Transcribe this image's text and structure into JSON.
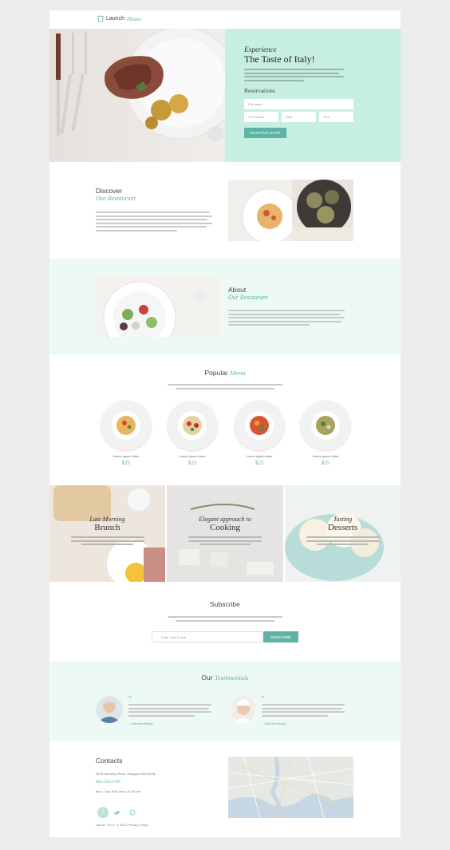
{
  "brand": {
    "name_a": "Launch",
    "name_b": "House"
  },
  "hero": {
    "pre": "Experience",
    "title": "The Taste of Italy!",
    "reservations_label": "Reservations",
    "name_placeholder": "Full name",
    "guests_placeholder": "# of Guests",
    "date_placeholder": "Date",
    "time_placeholder": "Time",
    "reserve_button": "RESERVE NOW!"
  },
  "discover": {
    "title": "Discover",
    "subtitle": "Our Restaurant"
  },
  "about": {
    "title": "About",
    "subtitle": "Our Restaurant"
  },
  "menu": {
    "title": "Popular",
    "title_accent": "Menu",
    "dishes": [
      {
        "name": "Lorem ipsum dolor",
        "price": "$25"
      },
      {
        "name": "Lorem ipsum dolor",
        "price": "$25"
      },
      {
        "name": "Lorem ipsum dolor",
        "price": "$25"
      },
      {
        "name": "Lorem ipsum dolor",
        "price": "$25"
      }
    ]
  },
  "panels": [
    {
      "pre": "Late Morning",
      "title": "Brunch"
    },
    {
      "pre": "Elegant approach to",
      "title": "Cooking"
    },
    {
      "pre": "Tasting",
      "title": "Desserts"
    }
  ],
  "subscribe": {
    "title": "Subscribe",
    "email_placeholder": "Enter Your E-mail",
    "button": "SUBSCRIBE"
  },
  "testimonials": {
    "title": "Our",
    "title_accent": "Testimonials",
    "items": [
      {
        "author": "– Edmond Bergin"
      },
      {
        "author": "– Edmond Bergin"
      }
    ]
  },
  "contacts": {
    "title": "Contacts",
    "address": "3578 Harmony Road, Glasgow D04 89GB",
    "phone": "800-2345-6789",
    "hours": "Mon - Sun 8:00 am to 11:00 pm",
    "footer_brand_a": "Launch",
    "footer_brand_b": "House",
    "footer_rest": "© 2015 | Privacy Policy"
  },
  "colors": {
    "accent": "#5fb3a5",
    "mint": "#c7eee3",
    "mint_light": "#edf9f5"
  }
}
